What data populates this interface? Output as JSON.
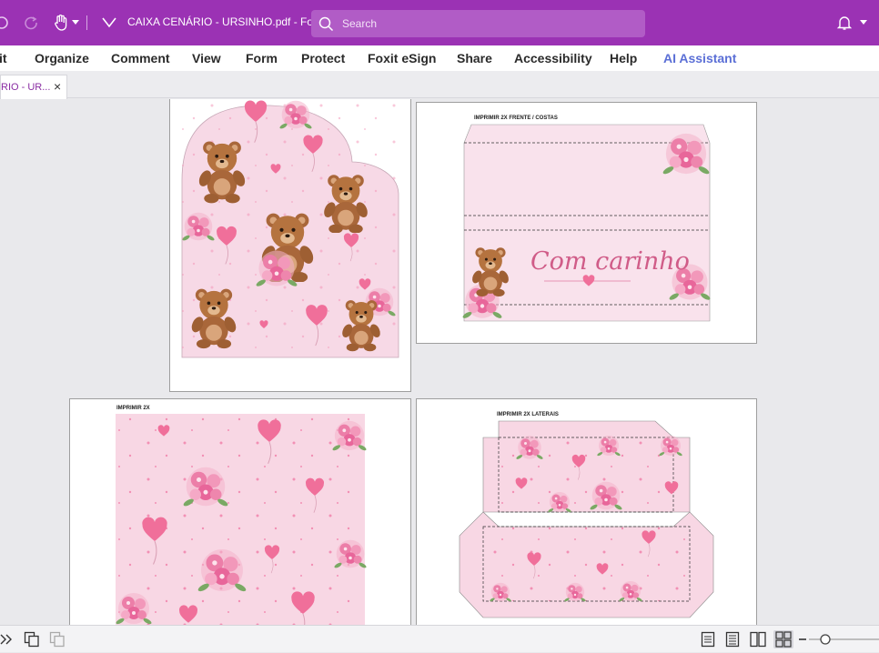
{
  "titlebar": {
    "doc_title": "CAIXA CENÁRIO - URSINHO.pdf - Fox...",
    "search_placeholder": "Search"
  },
  "ribbon": {
    "items": [
      "it",
      "Organize",
      "Comment",
      "View",
      "Form",
      "Protect",
      "Foxit eSign",
      "Share",
      "Accessibility",
      "Help",
      "AI Assistant"
    ]
  },
  "tabs": [
    {
      "label": "RIO - UR...",
      "close": "×"
    }
  ],
  "pages": {
    "p2_label": "IMPRIMIR 2X FRENTE / COSTAS",
    "p2_banner": "Com carinho",
    "p3_label": "IMPRIMIR 2X",
    "p4_label": "IMPRIMIR 2X LATERAIS"
  },
  "colors": {
    "brand": "#9b32b4",
    "search_bg": "#b15cc6",
    "accent_ai": "#5b6fd6",
    "paper_pink": "#f7d9e6",
    "heart_pink": "#f06f9a",
    "flower_pink": "#e8669a",
    "bear_brown": "#a9673a"
  }
}
